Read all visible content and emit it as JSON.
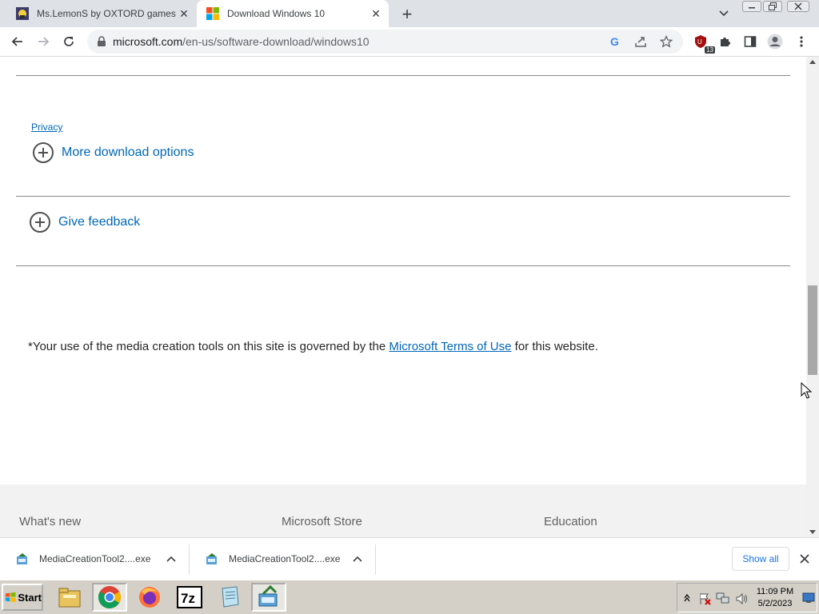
{
  "browser": {
    "tabs": [
      {
        "title": "Ms.LemonS by OXTORD games",
        "active": false,
        "favicon": "game-favicon-icon"
      },
      {
        "title": "Download Windows 10",
        "active": true,
        "favicon": "microsoft-logo-icon"
      }
    ],
    "address": {
      "domain": "microsoft.com",
      "path": "/en-us/software-download/windows10"
    },
    "extension_badge": "13"
  },
  "page": {
    "privacy_link": "Privacy",
    "more_download_options": "More download options",
    "give_feedback": "Give feedback",
    "terms_prefix": "*Your use of the media creation tools on this site is governed by the ",
    "terms_link": "Microsoft Terms of Use",
    "terms_suffix": " for this website.",
    "footer_columns": [
      "What's new",
      "Microsoft Store",
      "Education"
    ]
  },
  "downloads": {
    "items": [
      {
        "name": "MediaCreationTool2....exe"
      },
      {
        "name": "MediaCreationTool2....exe"
      }
    ],
    "show_all": "Show all"
  },
  "taskbar": {
    "start_label": "Start",
    "quick_launch": [
      "file-manager-icon",
      "chrome-icon",
      "firefox-icon",
      "7zip-icon",
      "notepad-icon",
      "media-creation-tool-icon"
    ],
    "clock_time": "11:09 PM",
    "clock_date": "5/2/2023"
  },
  "colors": {
    "link": "#0067b8",
    "tabstrip": "#dee1e6",
    "taskbar": "#d4d0c8",
    "footer": "#f2f2f2"
  }
}
